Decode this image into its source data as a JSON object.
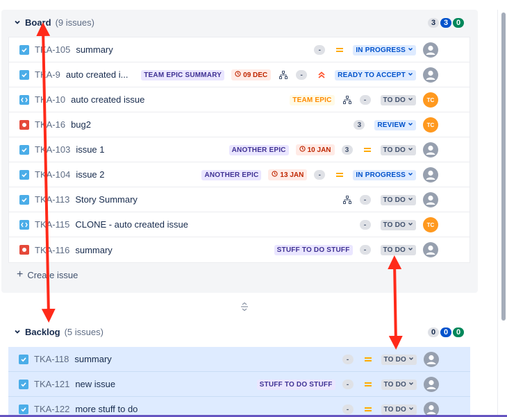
{
  "board": {
    "title": "Board",
    "count_label": "(9 issues)",
    "counts": [
      "3",
      "3",
      "0"
    ],
    "create_label": "Create issue",
    "rows": [
      {
        "key": "TKA-105",
        "summary": "summary",
        "type": "task",
        "epic": "",
        "date": "",
        "tree": false,
        "estimate": "-",
        "priority": "medium",
        "status": "IN PROGRESS",
        "status_style": "blue",
        "assignee": ""
      },
      {
        "key": "TKA-9",
        "summary": "auto created i...",
        "type": "task",
        "epic": "TEAM EPIC SUMMARY",
        "epic_style": "purple",
        "date": "09 DEC",
        "tree": true,
        "estimate": "-",
        "priority": "high",
        "status": "READY TO ACCEPT",
        "status_style": "blue",
        "assignee": ""
      },
      {
        "key": "TKA-10",
        "summary": "auto created issue",
        "type": "subtask",
        "epic": "TEAM EPIC",
        "epic_style": "orange",
        "date": "",
        "tree": true,
        "estimate": "-",
        "priority": "",
        "status": "TO DO",
        "status_style": "grey",
        "assignee": "TC"
      },
      {
        "key": "TKA-16",
        "summary": "bug2",
        "type": "bug",
        "epic": "",
        "date": "",
        "tree": false,
        "estimate": "3",
        "priority": "",
        "status": "REVIEW",
        "status_style": "blue",
        "assignee": "TC"
      },
      {
        "key": "TKA-103",
        "summary": "issue 1",
        "type": "task",
        "epic": "ANOTHER EPIC",
        "epic_style": "purple",
        "date": "10 JAN",
        "tree": false,
        "estimate": "3",
        "priority": "medium",
        "status": "TO DO",
        "status_style": "grey",
        "assignee": ""
      },
      {
        "key": "TKA-104",
        "summary": "issue 2",
        "type": "task",
        "epic": "ANOTHER EPIC",
        "epic_style": "purple",
        "date": "13 JAN",
        "tree": false,
        "estimate": "-",
        "priority": "medium",
        "status": "IN PROGRESS",
        "status_style": "blue",
        "assignee": ""
      },
      {
        "key": "TKA-113",
        "summary": "Story Summary",
        "type": "task",
        "epic": "",
        "date": "",
        "tree": true,
        "estimate": "-",
        "priority": "",
        "status": "TO DO",
        "status_style": "grey",
        "assignee": ""
      },
      {
        "key": "TKA-115",
        "summary": "CLONE - auto created issue",
        "type": "subtask",
        "epic": "",
        "date": "",
        "tree": false,
        "estimate": "-",
        "priority": "",
        "status": "TO DO",
        "status_style": "grey",
        "assignee": "TC"
      },
      {
        "key": "TKA-116",
        "summary": "summary",
        "type": "bug",
        "epic": "STUFF TO DO STUFF",
        "epic_style": "purple",
        "date": "",
        "tree": false,
        "estimate": "-",
        "priority": "",
        "status": "TO DO",
        "status_style": "grey",
        "assignee": ""
      }
    ]
  },
  "backlog": {
    "title": "Backlog",
    "count_label": "(5 issues)",
    "counts": [
      "0",
      "0",
      "0"
    ],
    "rows": [
      {
        "key": "TKA-118",
        "summary": "summary",
        "type": "task",
        "epic": "",
        "date": "",
        "tree": false,
        "estimate": "-",
        "priority": "medium",
        "status": "TO DO",
        "status_style": "grey",
        "assignee": ""
      },
      {
        "key": "TKA-121",
        "summary": "new issue",
        "type": "task",
        "epic": "STUFF TO DO STUFF",
        "epic_style": "purple",
        "date": "",
        "tree": false,
        "estimate": "-",
        "priority": "medium",
        "status": "TO DO",
        "status_style": "grey",
        "assignee": ""
      },
      {
        "key": "TKA-122",
        "summary": "more stuff to do",
        "type": "task",
        "epic": "",
        "date": "",
        "tree": false,
        "estimate": "-",
        "priority": "medium",
        "status": "TO DO",
        "status_style": "grey",
        "assignee": ""
      }
    ]
  },
  "colors": {
    "accent_blue": "#0052cc",
    "annotation_red": "#ff2a1a",
    "selected_row": "#deebff"
  },
  "icons": {
    "chevron": "chevron-down-icon",
    "task": "checkbox-icon",
    "subtask": "subtask-icon",
    "bug": "bug-icon",
    "tree": "hierarchy-icon",
    "clock": "clock-icon",
    "priority_medium": "priority-medium-icon",
    "priority_high": "priority-high-icon",
    "avatar": "avatar-icon",
    "resize": "resize-handle-icon"
  }
}
